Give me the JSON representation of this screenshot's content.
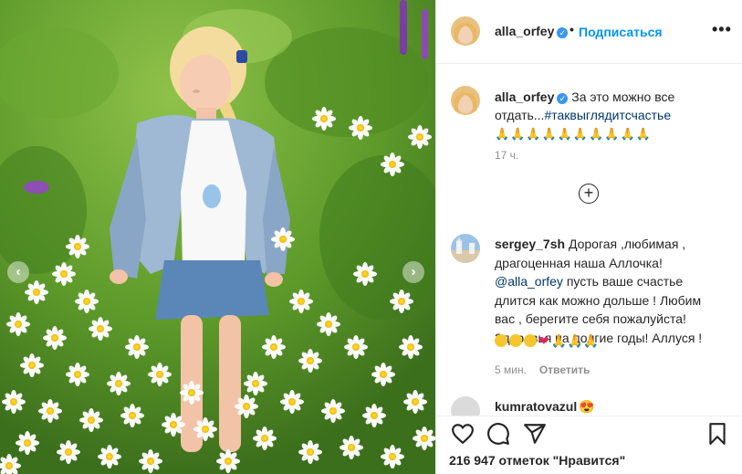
{
  "post": {
    "username": "alla_orfey",
    "follow_label": "Подписаться",
    "separator": "•",
    "more_label": "•••",
    "carousel_prev": "‹",
    "carousel_next": "›"
  },
  "caption": {
    "username": "alla_orfey",
    "text": "За это можно все отдать...",
    "hashtag": "#таквыглядитсчастье",
    "trailing_emoji": "🙏🙏🙏🙏🙏🙏🙏🙏🙏🙏",
    "time": "17 ч."
  },
  "load_more_label": "+",
  "comments": [
    {
      "username": "sergey_7sh",
      "text_before": "Дорогая ,любимая , драгоценная наша Аллочка!",
      "mention": "@alla_orfey",
      "text_after": "пусть ваше счастье длится как можно дольше ! Любим вас , берегите себя пожалуйста! Здоровья на долгие годы! Аллуся !",
      "emoji_faces": "😘😘😘",
      "emoji_heart": "❤",
      "emoji_pray": "🙏🙏🙏",
      "time": "5 мин.",
      "reply_label": "Ответить"
    },
    {
      "username": "kumratovazul",
      "emoji": "😍"
    }
  ],
  "actions": {
    "likes_count": "216 947",
    "likes_text": "отметок \"Нравится\""
  },
  "colors": {
    "accent": "#0095f6",
    "verified": "#3897f0",
    "text": "#262626",
    "muted": "#8e8e8e",
    "link": "#00376b",
    "border": "#efefef"
  },
  "icons": [
    "verified-icon",
    "more-icon",
    "load-more-icon",
    "heart-icon",
    "comment-icon",
    "share-icon",
    "bookmark-icon",
    "chevron-left-icon",
    "chevron-right-icon"
  ]
}
